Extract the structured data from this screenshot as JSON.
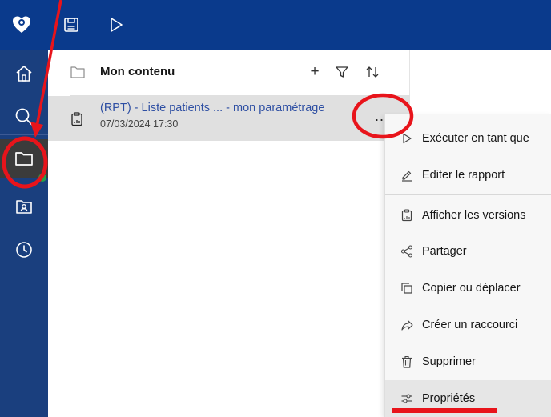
{
  "toolbar": {
    "logo_icon": "heart-logo-icon",
    "save_icon": "save-icon",
    "run_icon": "play-icon"
  },
  "rail": {
    "items": [
      {
        "name": "home",
        "icon": "home-icon"
      },
      {
        "name": "search",
        "icon": "search-icon"
      },
      {
        "name": "my-content",
        "icon": "folder-icon",
        "active": true
      },
      {
        "name": "team-content",
        "icon": "team-folder-icon"
      },
      {
        "name": "recent",
        "icon": "clock-icon"
      }
    ]
  },
  "panel": {
    "title": "Mon contenu",
    "add_label": "+",
    "filter_icon": "filter-icon",
    "sort_icon": "sort-icon"
  },
  "items": [
    {
      "name": "(RPT) - Liste patients ... - mon paramétrage",
      "date": "07/03/2024 17:30",
      "more_label": "..."
    }
  ],
  "menu": {
    "items": [
      {
        "label": "Exécuter en tant que",
        "icon": "play-outline-icon"
      },
      {
        "label": "Editer le rapport",
        "icon": "edit-icon"
      },
      {
        "label": "Afficher les versions",
        "icon": "versions-icon"
      },
      {
        "label": "Partager",
        "icon": "share-icon"
      },
      {
        "label": "Copier ou déplacer",
        "icon": "copy-icon"
      },
      {
        "label": "Créer un raccourci",
        "icon": "shortcut-icon"
      },
      {
        "label": "Supprimer",
        "icon": "trash-icon"
      },
      {
        "label": "Propriétés",
        "icon": "properties-icon"
      }
    ]
  },
  "colors": {
    "topbar": "#0a3a8c",
    "rail": "#1a3f7e",
    "annotation": "#e8141b",
    "link": "#2e4fa3"
  }
}
